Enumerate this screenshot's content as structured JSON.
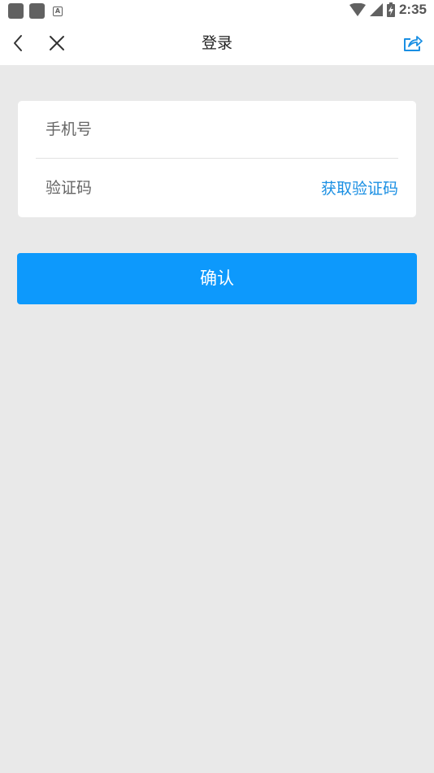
{
  "status_bar": {
    "time": "2:35",
    "icons": [
      "notification-square-icon",
      "notification-square-icon",
      "font-a-icon",
      "wifi-icon",
      "cell-signal-icon",
      "battery-charging-icon"
    ]
  },
  "nav": {
    "title": "登录",
    "back_icon": "chevron-left-icon",
    "close_icon": "close-icon",
    "share_icon": "share-icon"
  },
  "form": {
    "phone_placeholder": "手机号",
    "phone_value": "",
    "code_placeholder": "验证码",
    "code_value": "",
    "get_code_label": "获取验证码"
  },
  "confirm_label": "确认",
  "colors": {
    "accent": "#0d99fc",
    "link": "#1a8fe3",
    "background": "#e9e9e9"
  }
}
